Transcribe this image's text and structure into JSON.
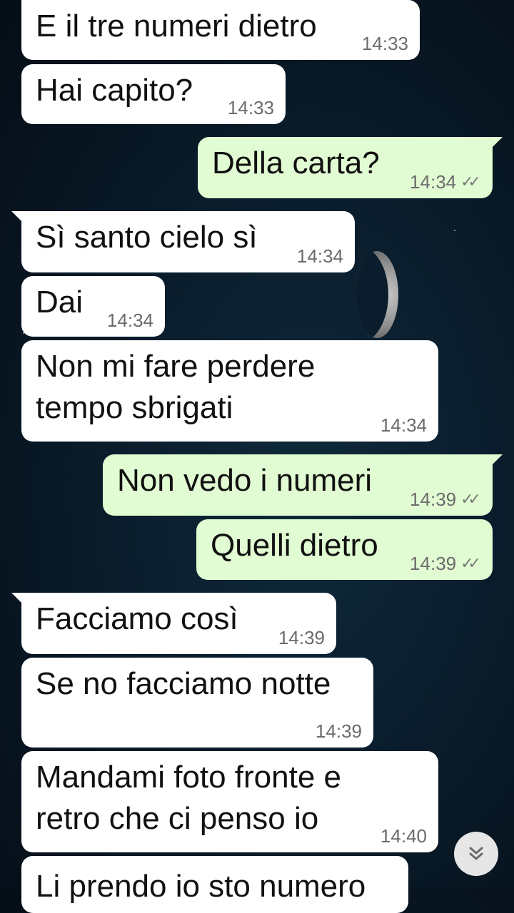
{
  "messages": [
    {
      "text": "E il tre numeri dietro",
      "time": "14:33",
      "dir": "in"
    },
    {
      "text": "Hai capito?",
      "time": "14:33",
      "dir": "in"
    },
    {
      "text": "Della carta?",
      "time": "14:34",
      "dir": "out"
    },
    {
      "text": "Sì santo cielo sì",
      "time": "14:34",
      "dir": "in"
    },
    {
      "text": "Dai",
      "time": "14:34",
      "dir": "in"
    },
    {
      "text": "Non mi fare perdere\ntempo sbrigati",
      "time": "14:34",
      "dir": "in"
    },
    {
      "text": "Non vedo i numeri",
      "time": "14:39",
      "dir": "out"
    },
    {
      "text": "Quelli dietro",
      "time": "14:39",
      "dir": "out"
    },
    {
      "text": "Facciamo così",
      "time": "14:39",
      "dir": "in"
    },
    {
      "text": "Se no facciamo notte",
      "time": "14:39",
      "dir": "in"
    },
    {
      "text": "Mandami foto fronte e\nretro che ci penso io",
      "time": "14:40",
      "dir": "in"
    },
    {
      "text": "Li prendo io sto numero",
      "time": "",
      "dir": "in"
    }
  ],
  "read_receipt_icon": "double-check-icon",
  "scroll_button_icon": "chevron-double-down-icon",
  "colors": {
    "incoming_bubble": "#ffffff",
    "outgoing_bubble": "#e1fbd3",
    "timestamp": "#6b6b6b"
  }
}
